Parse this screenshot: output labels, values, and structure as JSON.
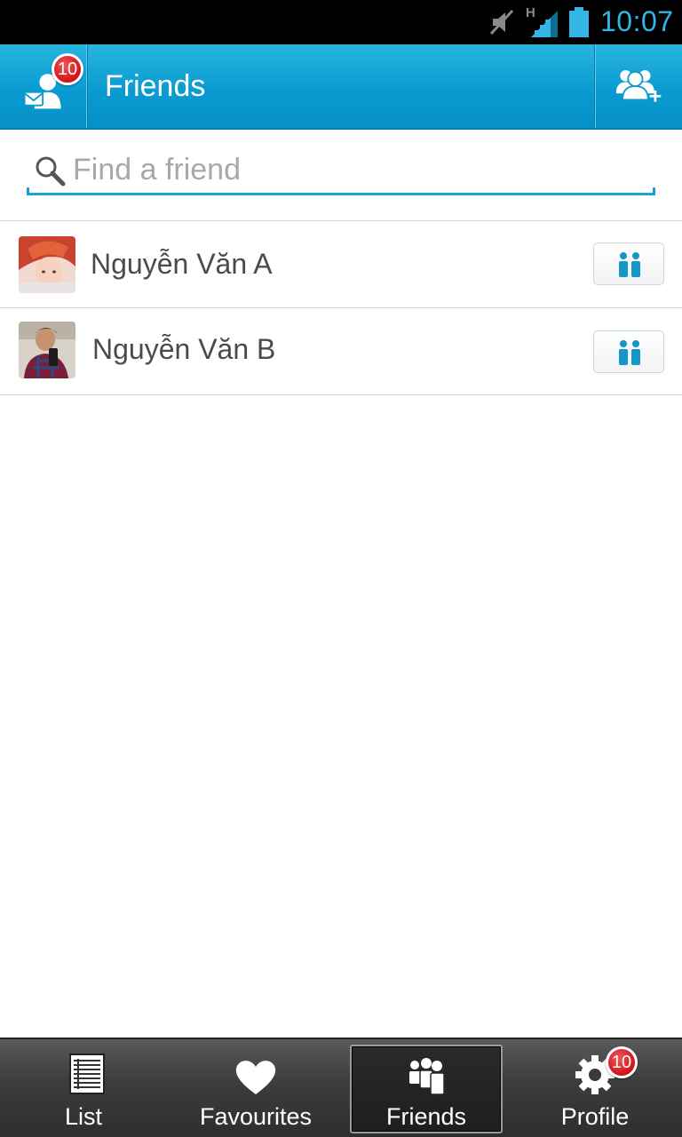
{
  "status_bar": {
    "time": "10:07",
    "network_label": "H",
    "icons": [
      "mute-icon",
      "signal-icon",
      "battery-icon"
    ],
    "accent_color": "#33b5e5"
  },
  "action_bar": {
    "title": "Friends",
    "left_icon": "messages-user-icon",
    "left_badge": "10",
    "right_icon": "add-friend-icon",
    "color": "#0a9bd0"
  },
  "search": {
    "placeholder": "Find a friend",
    "value": ""
  },
  "friends": [
    {
      "name": "Nguyễn Văn A",
      "action_icon": "friends-status-icon"
    },
    {
      "name": "Nguyễn Văn B",
      "action_icon": "friends-status-icon"
    }
  ],
  "tabs": [
    {
      "label": "List",
      "icon": "list-icon",
      "active": false
    },
    {
      "label": "Favourites",
      "icon": "heart-icon",
      "active": false
    },
    {
      "label": "Friends",
      "icon": "friends-icon",
      "active": true
    },
    {
      "label": "Profile",
      "icon": "gear-icon",
      "active": false,
      "badge": "10"
    }
  ],
  "colors": {
    "badge": "#d1141b",
    "icon_blue": "#1596c9"
  }
}
